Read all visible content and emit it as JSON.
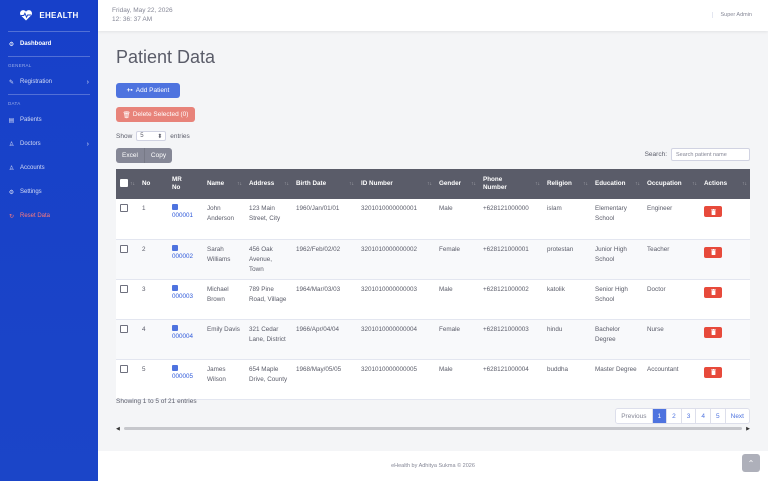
{
  "brand": {
    "name": "EHEALTH"
  },
  "sidebar": {
    "dashboard": "Dashboard",
    "heading_general": "GENERAL",
    "registration": "Registration",
    "heading_data": "DATA",
    "patients": "Patients",
    "doctors": "Doctors",
    "accounts": "Accounts",
    "settings": "Settings",
    "reset": "Reset Data"
  },
  "topbar": {
    "date": "Friday, May 22, 2026",
    "time": "12: 36: 37 AM",
    "user": "Super Admin"
  },
  "page": {
    "title": "Patient Data",
    "add_label": "Add Patient",
    "delete_label": "Delete Selected (0)",
    "show_label": "Show",
    "entries_value": "5",
    "entries_label": "entries",
    "excel": "Excel",
    "copy": "Copy",
    "search_label": "Search:",
    "search_placeholder": "Search patient name"
  },
  "table": {
    "headers": {
      "no": "No",
      "mr1": "MR",
      "mr2": "No",
      "name": "Name",
      "address": "Address",
      "birth": "Birth Date",
      "id": "ID Number",
      "gender": "Gender",
      "phone1": "Phone",
      "phone2": "Number",
      "religion": "Religion",
      "education": "Education",
      "occupation": "Occupation",
      "actions": "Actions"
    },
    "rows": [
      {
        "no": "1",
        "mr": "000001",
        "name": "John Anderson",
        "address": "123 Main Street, City",
        "birth": "1960/Jan/01/01",
        "id": "3201010000000001",
        "gender": "Male",
        "phone": "+628121000000",
        "religion": "islam",
        "education": "Elementary School",
        "occupation": "Engineer"
      },
      {
        "no": "2",
        "mr": "000002",
        "name": "Sarah Williams",
        "address": "456 Oak Avenue, Town",
        "birth": "1962/Feb/02/02",
        "id": "3201010000000002",
        "gender": "Female",
        "phone": "+628121000001",
        "religion": "protestan",
        "education": "Junior High School",
        "occupation": "Teacher"
      },
      {
        "no": "3",
        "mr": "000003",
        "name": "Michael Brown",
        "address": "789 Pine Road, Village",
        "birth": "1964/Mar/03/03",
        "id": "3201010000000003",
        "gender": "Male",
        "phone": "+628121000002",
        "religion": "katolik",
        "education": "Senior High School",
        "occupation": "Doctor"
      },
      {
        "no": "4",
        "mr": "000004",
        "name": "Emily Davis",
        "address": "321 Cedar Lane, District",
        "birth": "1966/Apr/04/04",
        "id": "3201010000000004",
        "gender": "Female",
        "phone": "+628121000003",
        "religion": "hindu",
        "education": "Bachelor Degree",
        "occupation": "Nurse"
      },
      {
        "no": "5",
        "mr": "000005",
        "name": "James Wilson",
        "address": "654 Maple Drive, County",
        "birth": "1968/May/05/05",
        "id": "3201010000000005",
        "gender": "Male",
        "phone": "+628121000004",
        "religion": "buddha",
        "education": "Master Degree",
        "occupation": "Accountant"
      }
    ]
  },
  "pagination": {
    "showing": "Showing 1 to 5 of 21 entries",
    "previous": "Previous",
    "pages": [
      "1",
      "2",
      "3",
      "4",
      "5"
    ],
    "next": "Next"
  },
  "footer": {
    "text": "eHealth by Adhitya Sukma © 2026"
  },
  "colors": {
    "primary": "#4e73df",
    "sidebar": "#1b45c8",
    "danger": "#e74a3b",
    "dark_header": "#5a5c69"
  }
}
